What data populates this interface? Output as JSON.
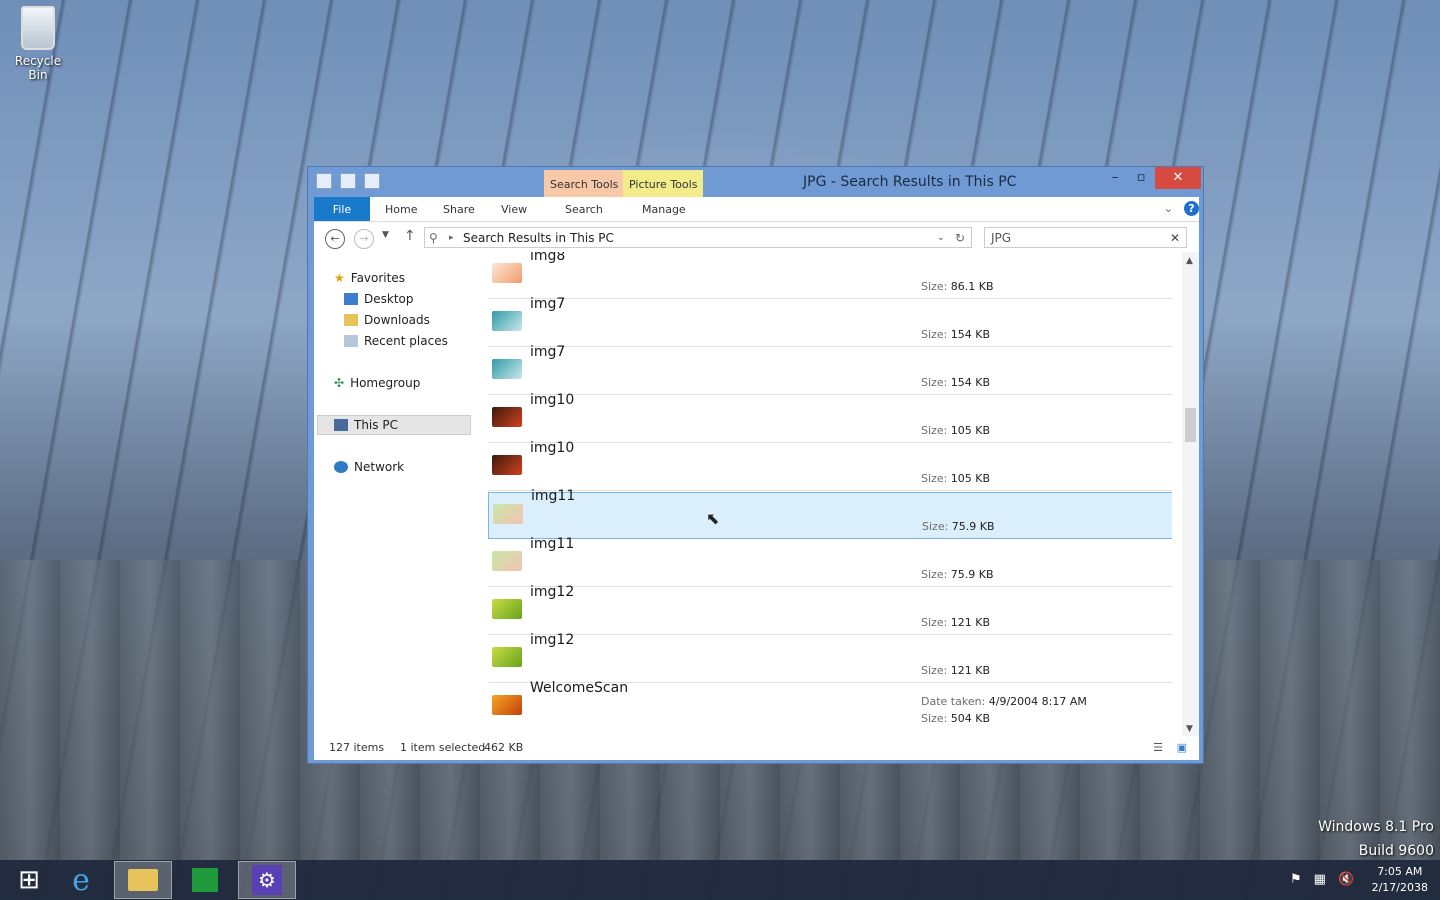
{
  "desktop": {
    "recycle_bin_label": "Recycle Bin",
    "watermark_line1": "Windows 8.1 Pro",
    "watermark_line2": "Build 9600"
  },
  "window": {
    "title": "JPG - Search Results in This PC",
    "search_tools_label": "Search Tools",
    "picture_tools_label": "Picture Tools",
    "ribbon_tabs": {
      "file": "File",
      "home": "Home",
      "share": "Share",
      "view": "View",
      "search": "Search",
      "manage": "Manage"
    },
    "address": "Search Results in This PC",
    "search_value": "JPG"
  },
  "nav": {
    "favorites": "Favorites",
    "desktop": "Desktop",
    "downloads": "Downloads",
    "recent_places": "Recent places",
    "homegroup": "Homegroup",
    "this_pc": "This PC",
    "network": "Network"
  },
  "files": [
    {
      "name": "img8",
      "size_label": "Size:",
      "size": "86.1 KB"
    },
    {
      "name": "img7",
      "size_label": "Size:",
      "size": "154 KB"
    },
    {
      "name": "img7",
      "size_label": "Size:",
      "size": "154 KB"
    },
    {
      "name": "img10",
      "size_label": "Size:",
      "size": "105 KB"
    },
    {
      "name": "img10",
      "size_label": "Size:",
      "size": "105 KB"
    },
    {
      "name": "img11",
      "size_label": "Size:",
      "size": "75.9 KB"
    },
    {
      "name": "img11",
      "size_label": "Size:",
      "size": "75.9 KB"
    },
    {
      "name": "img12",
      "size_label": "Size:",
      "size": "121 KB"
    },
    {
      "name": "img12",
      "size_label": "Size:",
      "size": "121 KB"
    },
    {
      "name": "WelcomeScan",
      "date_label": "Date taken:",
      "date": "4/9/2004 8:17 AM",
      "size_label": "Size:",
      "size": "504 KB"
    }
  ],
  "status": {
    "items": "127 items",
    "selected": "1 item selected",
    "size": "462 KB"
  },
  "taskbar": {
    "time": "7:05 AM",
    "date": "2/17/2038"
  },
  "colors": {
    "window_frame": "#6f9ad3",
    "file_tab": "#1979ca",
    "close_button": "#d64a3f",
    "selection": "#dbeefb"
  }
}
